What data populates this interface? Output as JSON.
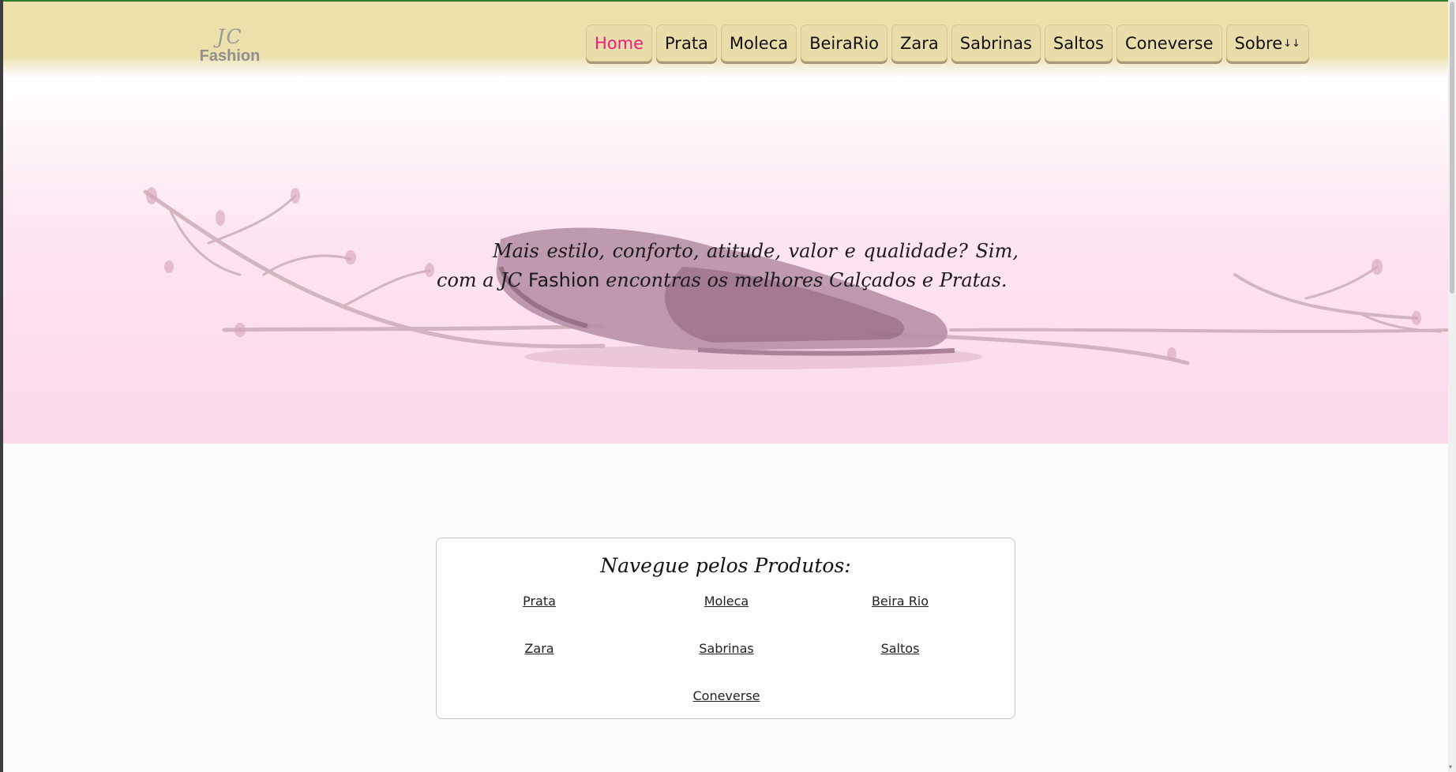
{
  "header": {
    "logo": {
      "mark": "JC",
      "text": "Fashion"
    },
    "nav": [
      {
        "label": "Home",
        "active": true
      },
      {
        "label": "Prata"
      },
      {
        "label": "Moleca"
      },
      {
        "label": "BeiraRio"
      },
      {
        "label": "Zara"
      },
      {
        "label": "Sabrinas"
      },
      {
        "label": "Saltos"
      },
      {
        "label": "Coneverse"
      },
      {
        "label": "Sobre",
        "suffix": "↓↓"
      }
    ]
  },
  "hero": {
    "text_before": "Mais estilo, conforto, atitude, valor e qualidade? Sim, com a JC",
    "brand": "Fashion",
    "text_after": "encontras os melhores Calçados e Pratas."
  },
  "products": {
    "title": "Navegue pelos Produtos:",
    "links": [
      "Prata",
      "Moleca",
      "Beira Rio",
      "Zara",
      "Sabrinas",
      "Saltos",
      "Coneverse"
    ]
  },
  "colors": {
    "header_bg": "#ece0ab",
    "active_nav": "#ee1b7f",
    "hero_pink": "#fcdaeb"
  }
}
